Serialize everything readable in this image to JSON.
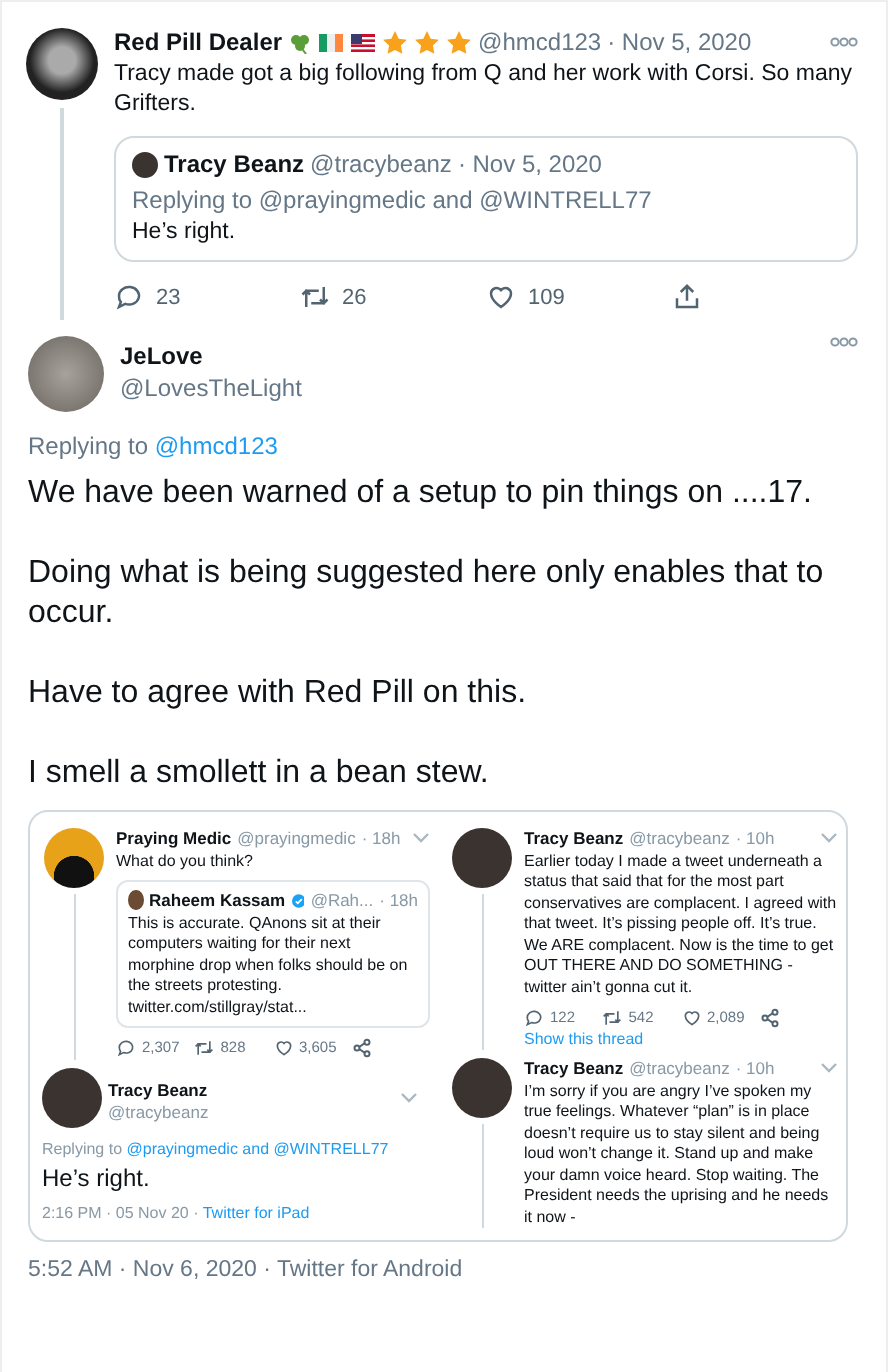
{
  "parent_tweet": {
    "name": "Red Pill Dealer",
    "handle": "@hmcd123",
    "date": "· Nov 5, 2020",
    "text": "Tracy made got a big following from Q and her work with Corsi. So many Grifters.",
    "quote": {
      "name": "Tracy Beanz",
      "handle": "@tracybeanz",
      "date": "· Nov 5, 2020",
      "replying_prefix": "Replying to",
      "replying_to": "@prayingmedic and @WINTRELL77",
      "text": "He’s right."
    },
    "actions": [
      {
        "kind": "reply",
        "count": "23"
      },
      {
        "kind": "retweet",
        "count": "26"
      },
      {
        "kind": "like",
        "count": "109"
      },
      {
        "kind": "share"
      }
    ]
  },
  "main_tweet": {
    "name": "JeLove",
    "handle": "@LovesTheLight",
    "replying_prefix": "Replying to",
    "replying_to": "@hmcd123",
    "paragraphs": [
      "We have been warned of a setup to pin things on ....17.",
      "Doing what is being suggested here only enables that to occur.",
      "Have to agree with Red Pill on this.",
      "I smell a smollett in a bean stew."
    ]
  },
  "embedded_screenshot": {
    "left_column": [
      {
        "kind": "tweet",
        "name": "Praying Medic",
        "handle": "@prayingmedic",
        "time": "· 18h",
        "text": "What do you think?",
        "quote": {
          "name": "Raheem Kassam",
          "verified": true,
          "handle": "@Rah...",
          "time": "· 18h",
          "text": "This is accurate. QAnons sit at their computers waiting for their next morphine drop when folks should be on the streets protesting. twitter.com/stillgray/stat..."
        },
        "actions": [
          {
            "kind": "reply",
            "count": "2,307"
          },
          {
            "kind": "retweet",
            "count": "828"
          },
          {
            "kind": "like",
            "count": "3,605"
          },
          {
            "kind": "share"
          }
        ]
      },
      {
        "kind": "detail",
        "name": "Tracy Beanz",
        "handle": "@tracybeanz",
        "replying_prefix": "Replying to",
        "replying_to": "@prayingmedic and @WINTRELL77",
        "text": "He’s right.",
        "time": "2:16 PM · 05 Nov 20 ·",
        "source": "Twitter for iPad"
      }
    ],
    "right_column": [
      {
        "kind": "tweet",
        "name": "Tracy Beanz",
        "handle": "@tracybeanz",
        "time": "· 10h",
        "text": "Earlier today I made a tweet underneath a status that said that for the most part conservatives are complacent. I agreed with that tweet. It’s pissing people off. It’s true. We ARE complacent. Now is the time to get OUT THERE AND DO SOMETHING - twitter ain’t gonna cut it.",
        "actions": [
          {
            "kind": "reply",
            "count": "122"
          },
          {
            "kind": "retweet",
            "count": "542"
          },
          {
            "kind": "like",
            "count": "2,089"
          },
          {
            "kind": "share"
          }
        ],
        "thread_link": "Show this thread"
      },
      {
        "kind": "tweet",
        "name": "Tracy Beanz",
        "handle": "@tracybeanz",
        "time": "· 10h",
        "text": "I’m sorry if you are angry I’ve spoken my true feelings. Whatever “plan” is in place doesn’t require us to stay silent and being loud won’t change it. Stand up and make your damn voice heard. Stop waiting. The President needs the uprising and he needs it now -"
      }
    ]
  },
  "timestamp": "5:52 AM · Nov 6, 2020 · Twitter for Android"
}
